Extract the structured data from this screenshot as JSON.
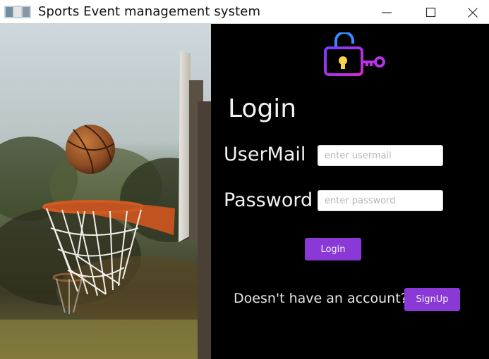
{
  "window": {
    "title": "Sports Event management system",
    "controls": [
      "minimize-icon",
      "maximize-icon",
      "close-icon"
    ]
  },
  "image": {
    "description_icon": "basketball-hoop-photo"
  },
  "form": {
    "icon": "lock-key-icon",
    "heading": "Login",
    "email_label": "UserMail",
    "email_placeholder": "enter usermail",
    "password_label": "Password",
    "password_placeholder": "enter password",
    "login_button": "Login",
    "signup_prompt": "Doesn't have an account?",
    "signup_button": "SignUp"
  },
  "colors": {
    "panel_bg": "#000000",
    "accent": "#8b39d6",
    "icon_gradient_start": "#7a3cff",
    "icon_gradient_end": "#d42ad0"
  }
}
